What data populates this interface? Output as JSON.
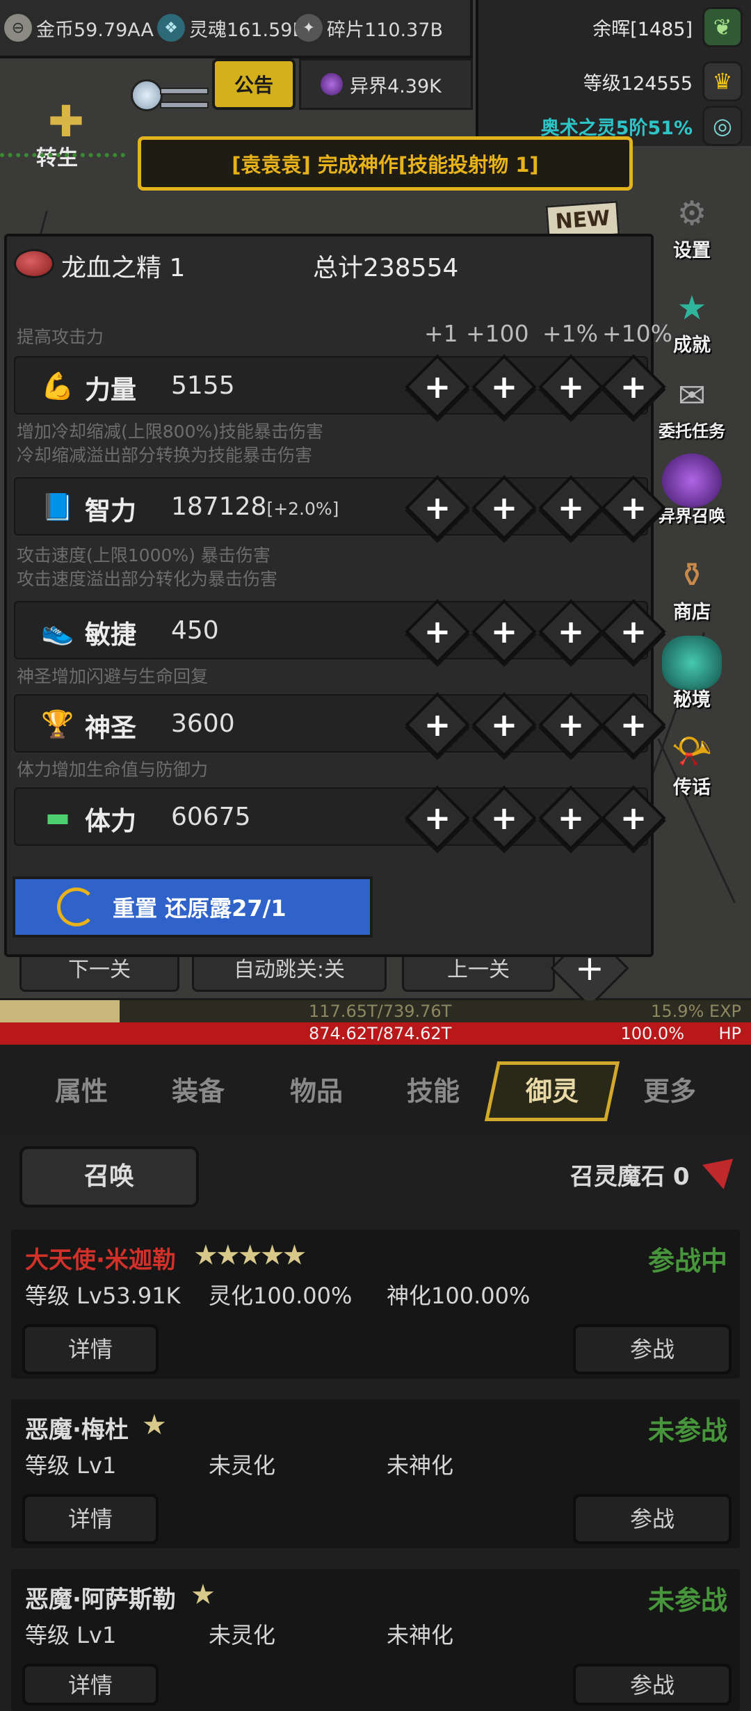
{
  "resources": [
    {
      "icon": "gold-coin-icon",
      "label": "金币59.79AA"
    },
    {
      "icon": "soul-icon",
      "label": "灵魂161.59B"
    },
    {
      "icon": "shard-icon",
      "label": "碎片110.37B"
    }
  ],
  "stats_panel": {
    "afterglow": "余晖[1485]",
    "level": "等级124555",
    "arcane": "奥术之灵5阶51%"
  },
  "notice_label": "公告",
  "other_world_label": "异界4.39K",
  "announcement": "[袁袁袁] 完成神作[技能投射物 1]",
  "rebirth_label": "转生",
  "side_menu": [
    {
      "id": "settings",
      "label": "设置"
    },
    {
      "id": "achievements",
      "label": "成就"
    },
    {
      "id": "commissions",
      "label": "委托任务"
    },
    {
      "id": "otherworld-summon",
      "label": "异界召唤"
    },
    {
      "id": "shop",
      "label": "商店"
    },
    {
      "id": "secret-realm",
      "label": "秘境"
    },
    {
      "id": "legend",
      "label": "传话"
    }
  ],
  "scene_nav": {
    "next": "下一关",
    "auto_skip": "自动跳关:关",
    "prev": "上一关",
    "plus": "+"
  },
  "alloc": {
    "essence_label": "龙血之精 1",
    "total_label": "总计238554",
    "columns": [
      "+1",
      "+100",
      "+1%",
      "+10%"
    ],
    "plus_glyph": "+",
    "descriptions": {
      "strength": "提高攻击力",
      "intellect_1": "增加冷却缩减(上限800%)技能暴击伤害",
      "intellect_2": "冷却缩减溢出部分转换为技能暴击伤害",
      "agility_1": "攻击速度(上限1000%) 暴击伤害",
      "agility_2": "攻击速度溢出部分转化为暴击伤害",
      "holy": "神圣增加闪避与生命回复",
      "stamina": "体力增加生命值与防御力"
    },
    "attributes": [
      {
        "name": "力量",
        "value": "5155",
        "bonus": ""
      },
      {
        "name": "智力",
        "value": "187128",
        "bonus": "[+2.0%]"
      },
      {
        "name": "敏捷",
        "value": "450",
        "bonus": ""
      },
      {
        "name": "神圣",
        "value": "3600",
        "bonus": ""
      },
      {
        "name": "体力",
        "value": "60675",
        "bonus": ""
      }
    ],
    "reset_label": "重置 还原露27/1"
  },
  "exp": {
    "text": "117.65T/739.76T",
    "percent_label": "15.9% EXP",
    "fraction": 0.159
  },
  "hp": {
    "text": "874.62T/874.62T",
    "percent_label": "100.0%",
    "unit": "HP"
  },
  "tabs": [
    "属性",
    "装备",
    "物品",
    "技能",
    "御灵",
    "更多"
  ],
  "active_tab": "御灵",
  "summon": {
    "button": "召唤",
    "stone_label": "召灵魔石 0"
  },
  "spirits": [
    {
      "name": "大天使·米迦勒",
      "stars": "★★★★★",
      "status": "参战中",
      "level": "等级 Lv53.91K",
      "spirit": "灵化100.00%",
      "divine": "神化100.00%",
      "detail": "详情",
      "join": "参战"
    },
    {
      "name": "恶魔·梅杜",
      "stars": "★",
      "status": "未参战",
      "level": "等级 Lv1",
      "spirit": "未灵化",
      "divine": "未神化",
      "detail": "详情",
      "join": "参战"
    },
    {
      "name": "恶魔·阿萨斯勒",
      "stars": "★",
      "status": "未参战",
      "level": "等级 Lv1",
      "spirit": "未灵化",
      "divine": "未神化",
      "detail": "详情",
      "join": "参战"
    }
  ],
  "colors": {
    "accent_gold": "#e7b21a",
    "legendary_name": "#d2312a",
    "status_green": "#48963c",
    "hp_red": "#b8181a",
    "reset_blue": "#2f63c9"
  }
}
